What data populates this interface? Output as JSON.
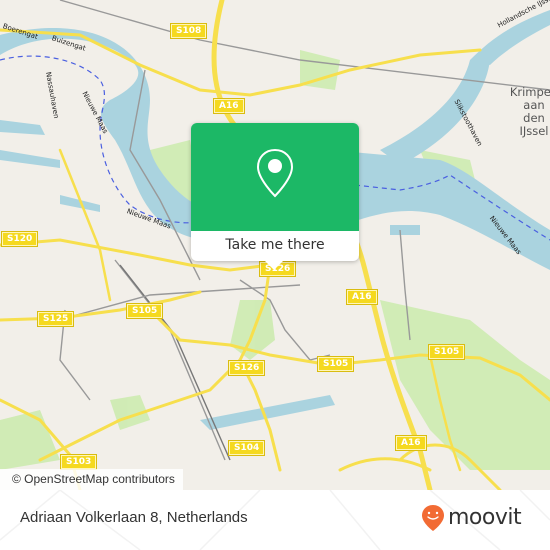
{
  "map": {
    "attribution": "© OpenStreetMap contributors",
    "colors": {
      "land": "#f2efe9",
      "water": "#aad3df",
      "green": "#cdebb0",
      "road": "#f7df4d",
      "rail": "#999999",
      "route_dash": "#4a5fe0"
    },
    "road_shields": [
      {
        "id": "s108",
        "label": "S108"
      },
      {
        "id": "a16-north",
        "label": "A16"
      },
      {
        "id": "s120",
        "label": "S120"
      },
      {
        "id": "s126-top",
        "label": "S126"
      },
      {
        "id": "a16-mid",
        "label": "A16"
      },
      {
        "id": "s125",
        "label": "S125"
      },
      {
        "id": "s105-west",
        "label": "S105"
      },
      {
        "id": "s126",
        "label": "S126"
      },
      {
        "id": "s105-mid",
        "label": "S105"
      },
      {
        "id": "s105-east",
        "label": "S105"
      },
      {
        "id": "a16-south",
        "label": "A16"
      },
      {
        "id": "s104",
        "label": "S104"
      },
      {
        "id": "s103",
        "label": "S103"
      }
    ],
    "water_labels": [
      {
        "id": "boerengat",
        "label": "Boerengat"
      },
      {
        "id": "buizengat",
        "label": "Buizengat"
      },
      {
        "id": "nassauhaven",
        "label": "Nassauhaven"
      },
      {
        "id": "nieuwe-maas-1",
        "label": "Nieuwe Maas"
      },
      {
        "id": "nieuwe-maas-2",
        "label": "Nieuwe Maas"
      },
      {
        "id": "nieuwe-maas-3",
        "label": "Nieuwe Maas"
      },
      {
        "id": "slikstoothaven",
        "label": "Slikstoothaven"
      },
      {
        "id": "hollandsche-ijssel",
        "label": "Hollandsche IJssel"
      }
    ],
    "place_labels": [
      {
        "id": "krimpen",
        "label": "Krimpen aan den IJssel",
        "lines": [
          "Krimpen",
          "aan",
          "den",
          "IJssel"
        ]
      }
    ]
  },
  "popup": {
    "accent": "#1cb866",
    "icon": "map-pin-icon",
    "button_label": "Take me there"
  },
  "footer": {
    "address": "Adriaan Volkerlaan 8, Netherlands",
    "brand": {
      "name": "moovit",
      "icon": "moovit-pin-icon",
      "icon_color": "#f26b34"
    }
  }
}
